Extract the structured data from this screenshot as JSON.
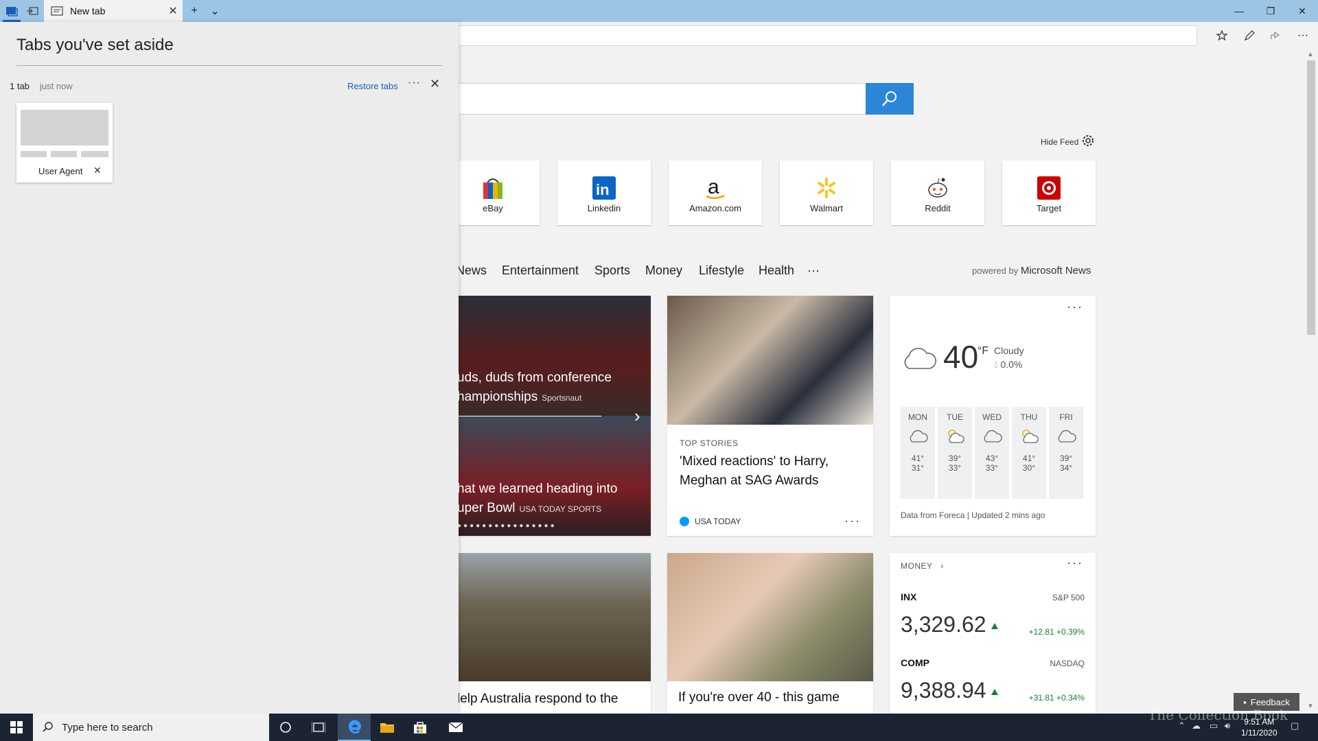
{
  "browser": {
    "tab_title": "New tab",
    "new_tab_glyph": "+",
    "tab_list_glyph": "⌄",
    "close_glyph": "✕",
    "min_glyph": "—",
    "max_glyph": "❐",
    "more_glyph": "···"
  },
  "newtab": {
    "hide_feed": "Hide Feed",
    "top_sites": [
      {
        "label": "eBay"
      },
      {
        "label": "Linkedin"
      },
      {
        "label": "Amazon.com"
      },
      {
        "label": "Walmart"
      },
      {
        "label": "Reddit"
      },
      {
        "label": "Target"
      }
    ],
    "categories": [
      "News",
      "Entertainment",
      "Sports",
      "Money",
      "Lifestyle",
      "Health",
      "···"
    ],
    "powered_by": "powered by",
    "powered_brand": "Microsoft News"
  },
  "feed": {
    "hero": {
      "headline1a": "uds, duds from conference",
      "headline1b": "hampionships",
      "source1": "Sportsnaut",
      "headline2a": "hat we learned heading into",
      "headline2b": "uper Bowl",
      "source2": "USA TODAY SPORTS"
    },
    "top_story": {
      "kicker": "TOP STORIES",
      "title": "'Mixed reactions' to Harry, Meghan at SAG Awards",
      "source": "USA TODAY"
    },
    "story_bottom_left": "lelp Australia respond to the",
    "story_bottom_mid": "If you're over 40 - this game"
  },
  "weather": {
    "temp": "40",
    "unit": "°F",
    "condition": "Cloudy",
    "precip": "0.0%",
    "days": [
      {
        "name": "MON",
        "hi": "41°",
        "lo": "31°",
        "icon": "cloud-icon"
      },
      {
        "name": "TUE",
        "hi": "39°",
        "lo": "33°",
        "icon": "partly-sunny-icon"
      },
      {
        "name": "WED",
        "hi": "43°",
        "lo": "33°",
        "icon": "cloud-icon"
      },
      {
        "name": "THU",
        "hi": "41°",
        "lo": "30°",
        "icon": "partly-sunny-icon"
      },
      {
        "name": "FRI",
        "hi": "39°",
        "lo": "34°",
        "icon": "cloud-icon"
      }
    ],
    "footer": "Data from Foreca | Updated 2 mins ago"
  },
  "money": {
    "header": "MONEY",
    "chevron": "›",
    "items": [
      {
        "ticker": "INX",
        "index": "S&P 500",
        "price": "3,329.62",
        "change": "+12.81 +0.39%"
      },
      {
        "ticker": "COMP",
        "index": "NASDAQ",
        "price": "9,388.94",
        "change": "+31.81 +0.34%"
      }
    ],
    "up_color": "#188038"
  },
  "feedback": "Feedback",
  "aside_panel": {
    "title": "Tabs you've set aside",
    "count": "1 tab",
    "time": "just now",
    "restore": "Restore tabs",
    "more": "···",
    "close": "✕",
    "tab_label": "User Agent",
    "tab_close": "✕"
  },
  "taskbar": {
    "search_placeholder": "Type here to search",
    "time": "9:51 AM",
    "date": "1/11/2020",
    "watermark": "The Collection Book"
  },
  "colors": {
    "titlebar": "#9cc4e4",
    "search_button": "#2b86d8",
    "link": "#1a5fb4",
    "taskbar": "#1c2431"
  }
}
